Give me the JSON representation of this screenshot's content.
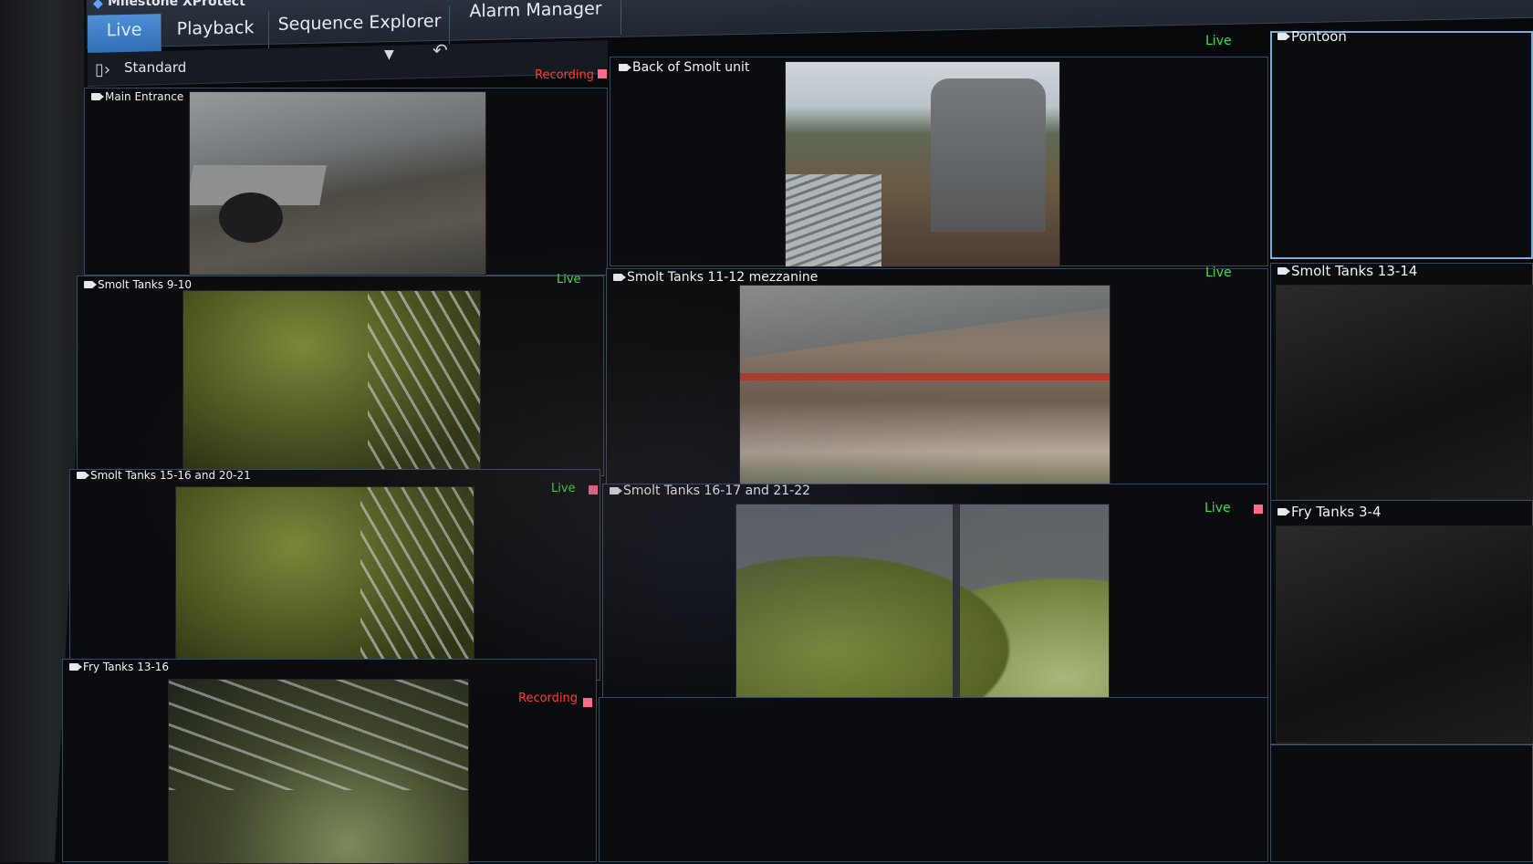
{
  "app": {
    "title": "Milestone XProtect",
    "tabs": [
      {
        "label": "Live",
        "active": true
      },
      {
        "label": "Playback",
        "active": false
      },
      {
        "label": "Sequence Explorer",
        "active": false
      },
      {
        "label": "Alarm Manager",
        "active": false
      }
    ]
  },
  "view": {
    "name": "Standard",
    "icons": {
      "panel": "panel-toggle-icon",
      "undo": "undo-icon",
      "dropdown": "chevron-down-icon"
    }
  },
  "status_labels": {
    "live": "Live",
    "recording": "Recording"
  },
  "cameras": [
    {
      "name": "Main Entrance",
      "status": "Recording"
    },
    {
      "name": "Back of Smolt unit",
      "status": "Live"
    },
    {
      "name": "Pontoon",
      "status": ""
    },
    {
      "name": "Smolt Tanks 9-10",
      "status": "Live"
    },
    {
      "name": "Smolt Tanks 11-12 mezzanine",
      "status": "Live"
    },
    {
      "name": "Smolt Tanks 13-14",
      "status": ""
    },
    {
      "name": "Smolt Tanks 15-16 and 20-21",
      "status": "Live"
    },
    {
      "name": "Smolt Tanks 16-17 and 21-22",
      "status": "Live"
    },
    {
      "name": "Fry Tanks 3-4",
      "status": ""
    },
    {
      "name": "Fry Tanks 13-16",
      "status": "Recording"
    }
  ],
  "colors": {
    "live": "#3fdc4a",
    "recording": "#ff3d2e",
    "active_tab": "#3f80c8",
    "highlight_border": "#7fa9d6"
  }
}
